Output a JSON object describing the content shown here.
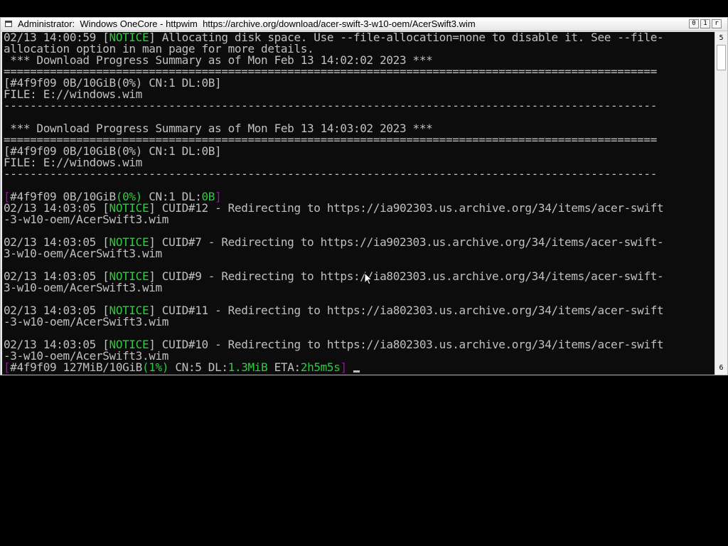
{
  "window": {
    "title": "Administrator:  Windows OneCore - httpwim  https://archive.org/download/acer-swift-3-w10-oem/AcerSwift3.wim",
    "min_label": "0",
    "max_label": "1",
    "close_label": "r"
  },
  "scrollbar": {
    "up_label": "5",
    "down_label": "6"
  },
  "console": {
    "lines": [
      [
        {
          "t": "02/13 14:00:59 [",
          "c": "w"
        },
        {
          "t": "NOTICE",
          "c": "g"
        },
        {
          "t": "] Allocating disk space. Use --file-allocation=none to disable it. See --file-",
          "c": "w"
        }
      ],
      [
        {
          "t": "allocation option in man page for more details.",
          "c": "w"
        }
      ],
      [
        {
          "t": " *** Download Progress Summary as of Mon Feb 13 14:02:02 2023 ***",
          "c": "w"
        }
      ],
      [
        {
          "t": "===================================================================================================",
          "c": "w"
        }
      ],
      [
        {
          "t": "[#4f9f09 0B/10GiB(0%) CN:1 DL:0B]",
          "c": "w"
        }
      ],
      [
        {
          "t": "FILE: E://windows.wim",
          "c": "w"
        }
      ],
      [
        {
          "t": "---------------------------------------------------------------------------------------------------",
          "c": "w"
        }
      ],
      [
        {
          "t": "",
          "c": "w"
        }
      ],
      [
        {
          "t": " *** Download Progress Summary as of Mon Feb 13 14:03:02 2023 ***",
          "c": "w"
        }
      ],
      [
        {
          "t": "===================================================================================================",
          "c": "w"
        }
      ],
      [
        {
          "t": "[#4f9f09 0B/10GiB(0%) CN:1 DL:0B]",
          "c": "w"
        }
      ],
      [
        {
          "t": "FILE: E://windows.wim",
          "c": "w"
        }
      ],
      [
        {
          "t": "---------------------------------------------------------------------------------------------------",
          "c": "w"
        }
      ],
      [
        {
          "t": "",
          "c": "w"
        }
      ],
      [
        {
          "t": "[",
          "c": "m"
        },
        {
          "t": "#4f9f09 0B/10GiB",
          "c": "w"
        },
        {
          "t": "(0%)",
          "c": "g"
        },
        {
          "t": " CN:1 DL:",
          "c": "w"
        },
        {
          "t": "0B",
          "c": "g"
        },
        {
          "t": "]",
          "c": "m"
        }
      ],
      [
        {
          "t": "02/13 14:03:05 [",
          "c": "w"
        },
        {
          "t": "NOTICE",
          "c": "g"
        },
        {
          "t": "] CUID#12 - Redirecting to https://ia902303.us.archive.org/34/items/acer-swift",
          "c": "w"
        }
      ],
      [
        {
          "t": "-3-w10-oem/AcerSwift3.wim",
          "c": "w"
        }
      ],
      [
        {
          "t": "",
          "c": "w"
        }
      ],
      [
        {
          "t": "02/13 14:03:05 [",
          "c": "w"
        },
        {
          "t": "NOTICE",
          "c": "g"
        },
        {
          "t": "] CUID#7 - Redirecting to https://ia902303.us.archive.org/34/items/acer-swift-",
          "c": "w"
        }
      ],
      [
        {
          "t": "3-w10-oem/AcerSwift3.wim",
          "c": "w"
        }
      ],
      [
        {
          "t": "",
          "c": "w"
        }
      ],
      [
        {
          "t": "02/13 14:03:05 [",
          "c": "w"
        },
        {
          "t": "NOTICE",
          "c": "g"
        },
        {
          "t": "] CUID#9 - Redirecting to https://ia802303.us.archive.org/34/items/acer-swift-",
          "c": "w"
        }
      ],
      [
        {
          "t": "3-w10-oem/AcerSwift3.wim",
          "c": "w"
        }
      ],
      [
        {
          "t": "",
          "c": "w"
        }
      ],
      [
        {
          "t": "02/13 14:03:05 [",
          "c": "w"
        },
        {
          "t": "NOTICE",
          "c": "g"
        },
        {
          "t": "] CUID#11 - Redirecting to https://ia802303.us.archive.org/34/items/acer-swift",
          "c": "w"
        }
      ],
      [
        {
          "t": "-3-w10-oem/AcerSwift3.wim",
          "c": "w"
        }
      ],
      [
        {
          "t": "",
          "c": "w"
        }
      ],
      [
        {
          "t": "02/13 14:03:05 [",
          "c": "w"
        },
        {
          "t": "NOTICE",
          "c": "g"
        },
        {
          "t": "] CUID#10 - Redirecting to https://ia802303.us.archive.org/34/items/acer-swift",
          "c": "w"
        }
      ],
      [
        {
          "t": "-3-w10-oem/AcerSwift3.wim",
          "c": "w"
        }
      ],
      [
        {
          "t": "[",
          "c": "m"
        },
        {
          "t": "#4f9f09 127MiB/10GiB",
          "c": "w"
        },
        {
          "t": "(1%)",
          "c": "g"
        },
        {
          "t": " CN:5 DL:",
          "c": "w"
        },
        {
          "t": "1.3MiB",
          "c": "g"
        },
        {
          "t": " ETA:",
          "c": "w"
        },
        {
          "t": "2h5m5s",
          "c": "g"
        },
        {
          "t": "]",
          "c": "m"
        }
      ]
    ]
  },
  "colors": {
    "console_bg": "#0c0c0c",
    "text": "#c0c0c0",
    "notice_green": "#2ecc40",
    "bracket_magenta": "#b000b0",
    "desktop_bg": "#000000"
  },
  "icons": {
    "system_menu": "console-window-icon",
    "pointer": "mouse-pointer-icon"
  }
}
